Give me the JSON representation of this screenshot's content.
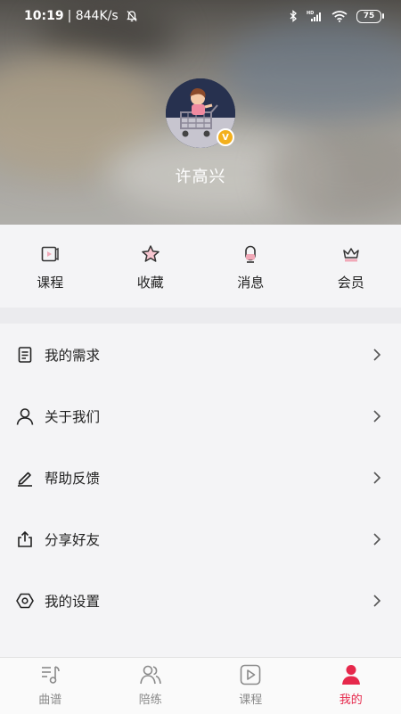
{
  "status_bar": {
    "time": "10:19",
    "network_speed": "| 844K/s",
    "battery_level": "75",
    "icons": [
      "bell-off-icon",
      "bluetooth-icon",
      "signal-icon",
      "wifi-icon",
      "battery-icon"
    ]
  },
  "profile": {
    "username": "许高兴",
    "vip_badge": "V"
  },
  "quick_actions": [
    {
      "label": "课程",
      "icon": "course-icon"
    },
    {
      "label": "收藏",
      "icon": "star-icon"
    },
    {
      "label": "消息",
      "icon": "bell-icon"
    },
    {
      "label": "会员",
      "icon": "crown-icon"
    }
  ],
  "menu": [
    {
      "label": "我的需求",
      "icon": "document-icon"
    },
    {
      "label": "关于我们",
      "icon": "person-icon"
    },
    {
      "label": "帮助反馈",
      "icon": "pen-icon"
    },
    {
      "label": "分享好友",
      "icon": "share-icon"
    },
    {
      "label": "我的设置",
      "icon": "settings-icon"
    }
  ],
  "bottom_nav": {
    "active": "我的",
    "items": [
      {
        "label": "曲谱",
        "icon": "music-note-icon"
      },
      {
        "label": "陪练",
        "icon": "people-icon"
      },
      {
        "label": "课程",
        "icon": "play-icon"
      },
      {
        "label": "我的",
        "icon": "person-filled-icon"
      }
    ]
  },
  "colors": {
    "accent": "#e6284b",
    "icon_pink": "#f1a9b8",
    "vip_badge": "#f3b01c"
  }
}
